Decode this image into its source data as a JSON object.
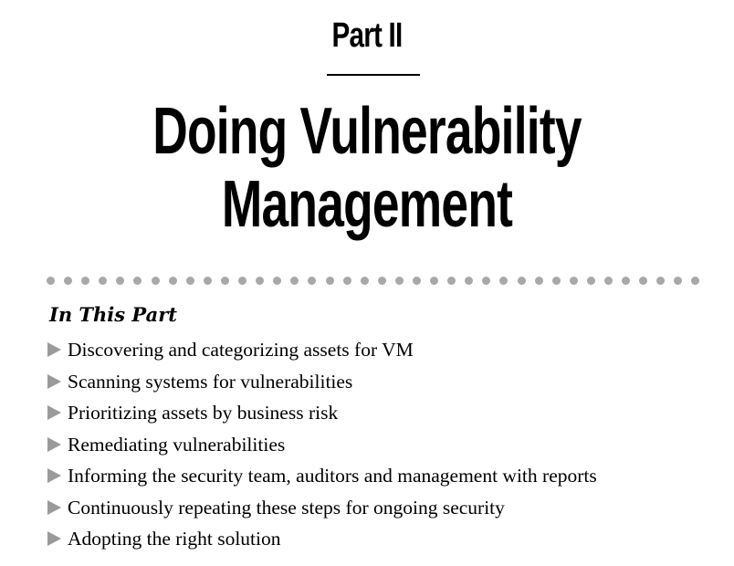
{
  "part_label": "Part II",
  "title": {
    "line1": "Doing Vulnerability",
    "line2": "Management"
  },
  "section_title": "In This Part",
  "items": [
    "Discovering and categorizing assets for VM",
    "Scanning systems for vulnerabilities",
    "Prioritizing assets by business risk",
    "Remediating vulnerabilities",
    "Informing the security team, auditors and management with reports",
    "Continuously repeating these steps for ongoing security",
    "Adopting the right solution"
  ],
  "colors": {
    "text": "#000000",
    "dots": "#a8a8a8",
    "bullet": "#9a9a9a",
    "background": "#ffffff"
  },
  "icons": {
    "bullet": "triangle-right-icon",
    "separator": "dot-separator"
  }
}
